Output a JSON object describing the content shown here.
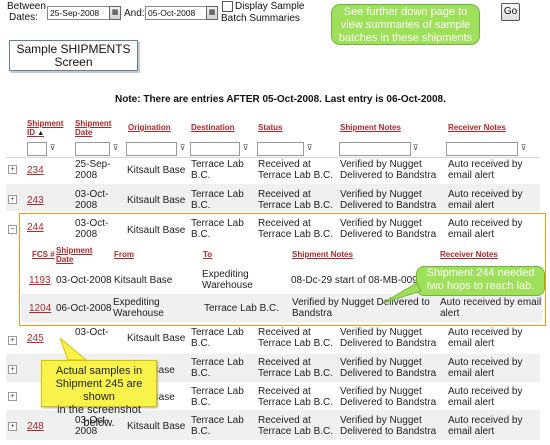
{
  "filters": {
    "between_label": "Between",
    "dates_label": "Dates:",
    "from_date": "25-Sep-2008",
    "and_label": "And:",
    "to_date": "05-Oct-2008",
    "display_label_1": "Display Sample",
    "display_label_2": "Batch Summaries",
    "go_label": "Go"
  },
  "callouts": {
    "green_top_1": "See further down page to",
    "green_top_2": "view summaries of sample",
    "green_top_3": "batches in these shipments",
    "screen_1": "Sample SHIPMENTS",
    "screen_2": "Screen",
    "green_mid_1": "Shipment 244 needed",
    "green_mid_2": "two hops to reach lab.",
    "yellow_1": "Actual samples in",
    "yellow_2": "Shipment 245 are shown",
    "yellow_3": "in the screenshot below."
  },
  "note": "Note: There are entries AFTER 05-Oct-2008. Last entry is 06-Oct-2008.",
  "table": {
    "headers": {
      "shipment_id_1": "Shipment",
      "shipment_id_2": "ID",
      "sort_arrow": "▲",
      "shipment_date_1": "Shipment",
      "shipment_date_2": "Date",
      "origination": "Origination",
      "destination": "Destination",
      "status": "Status",
      "notes": "Shipment Notes",
      "receiver": "Receiver Notes"
    },
    "rows": [
      {
        "id": "234",
        "date1": "25-Sep-",
        "date2": "2008",
        "orig": "Kitsault Base",
        "dest1": "Terrace Lab",
        "dest2": "B.C.",
        "status1": "Received at",
        "status2": "Terrace Lab B.C.",
        "notes1": "Verified by Nugget",
        "notes2": "Delivered to Bandstra",
        "recv1": "Auto received by",
        "recv2": "email alert"
      },
      {
        "id": "243",
        "date1": "03-Oct-",
        "date2": "2008",
        "orig": "Kitsault Base",
        "dest1": "Terrace Lab",
        "dest2": "B.C.",
        "status1": "Received at",
        "status2": "Terrace Lab B.C.",
        "notes1": "Verified by Nugget",
        "notes2": "Delivered to Bandstra",
        "recv1": "Auto received by",
        "recv2": "email alert"
      },
      {
        "id": "244",
        "date1": "03-Oct-",
        "date2": "2008",
        "orig": "Kitsault Base",
        "dest1": "Terrace Lab",
        "dest2": "B.C.",
        "status1": "Received at",
        "status2": "Terrace Lab B.C.",
        "notes1": "Verified by Nugget",
        "notes2": "Delivered to Bandstra",
        "recv1": "Auto received by",
        "recv2": "email alert"
      },
      {
        "id": "245",
        "date1": "03-Oct-",
        "date2": "",
        "orig": "Kitsault Base",
        "dest1": "Terrace Lab",
        "dest2": "B.C.",
        "status1": "Received at",
        "status2": "Terrace Lab B.C.",
        "notes1": "Verified by Nugget",
        "notes2": "Delivered to Bandstra",
        "recv1": "Auto received by",
        "recv2": "email alert"
      },
      {
        "id": "",
        "date1": "",
        "date2": "",
        "orig": "Base",
        "dest1": "Terrace Lab",
        "dest2": "B.C.",
        "status1": "Received at",
        "status2": "Terrace Lab B.C.",
        "notes1": "Verified by Nugget",
        "notes2": "Delivered to Bandstra",
        "recv1": "Auto received by",
        "recv2": "email alert"
      },
      {
        "id": "",
        "date1": "",
        "date2": "",
        "orig": "Base",
        "dest1": "Terrace Lab",
        "dest2": "B.C.",
        "status1": "Received at",
        "status2": "Terrace Lab B.C.",
        "notes1": "Verified by Nugget",
        "notes2": "Delivered to Bandstra",
        "recv1": "Auto received by",
        "recv2": "email alert"
      },
      {
        "id": "248",
        "date1": "03-Oct-",
        "date2": "2008",
        "orig": "Kitsault Base",
        "dest1": "Terrace Lab",
        "dest2": "B.C.",
        "status1": "Received at",
        "status2": "Terrace Lab B.C.",
        "notes1": "Verified by Nugget",
        "notes2": "Delivered to Bandstra",
        "recv1": "Auto received by",
        "recv2": "email alert"
      }
    ],
    "sub": {
      "headers": {
        "fcs": "FCS #",
        "ship_1": "Shipment",
        "ship_2": "Date",
        "from": "From",
        "to": "To",
        "notes": "Shipment Notes",
        "receiver": "Receiver Notes"
      },
      "rows": [
        {
          "fcs": "1193",
          "date": "03-Oct-2008",
          "from1": "Kitsault Base",
          "from2": "",
          "to1": "Expediting",
          "to2": "Warehouse",
          "notes1": "08-Dc-29 start of 08-MB-009",
          "notes2": "",
          "recv1": "",
          "recv2": ""
        },
        {
          "fcs": "1204",
          "date": "06-Oct-2008",
          "from1": "Expediting",
          "from2": "Warehouse",
          "to1": "Terrace Lab B.C.",
          "to2": "",
          "notes1": "Verified by Nugget Delivered to",
          "notes2": "Bandstra",
          "recv1": "Auto received by email",
          "recv2": "alert"
        }
      ]
    },
    "expand_plus": "+",
    "expand_minus": "−",
    "funnel": "⊽"
  }
}
